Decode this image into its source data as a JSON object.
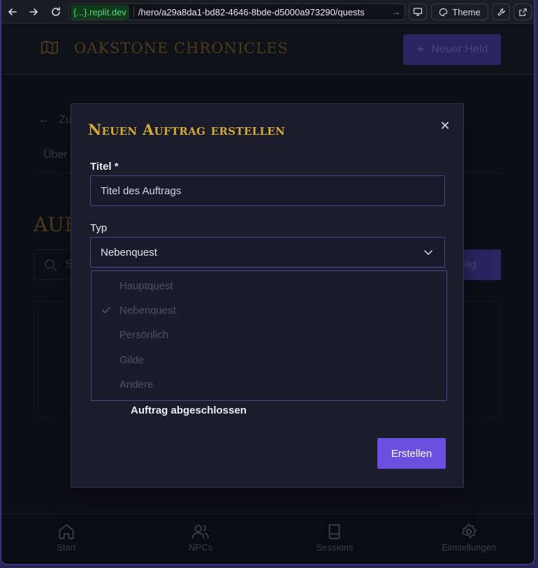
{
  "browser": {
    "url_host": "{...}.replit.dev",
    "url_path": "/hero/a29a8da1-bd82-4646-8bde-d5000a973290/quests",
    "theme_label": "Theme"
  },
  "app": {
    "brand": "OAKSTONE CHRONICLES",
    "new_hero_label": "Neuer Held",
    "back_partial": "Zu",
    "tab_partial": "Über",
    "heading_partial": "AUF",
    "search_partial": "S",
    "add_partial": "ftrag"
  },
  "modal": {
    "title": "Neuen Auftrag erstellen",
    "title_label": "Titel *",
    "title_placeholder": "Titel des Auftrags",
    "type_label": "Typ",
    "type_value": "Nebenquest",
    "type_options": [
      "Hauptquest",
      "Nebenquest",
      "Persönlich",
      "Gilde",
      "Andere"
    ],
    "completed_label": "Auftrag abgeschlossen",
    "create_label": "Erstellen"
  },
  "bottom_nav": {
    "items": [
      "Start",
      "NPCs",
      "Sessions",
      "Einstellungen"
    ]
  },
  "colors": {
    "accent": "#6a4fe0",
    "gold": "#d4a93b",
    "border": "#4b4590"
  }
}
